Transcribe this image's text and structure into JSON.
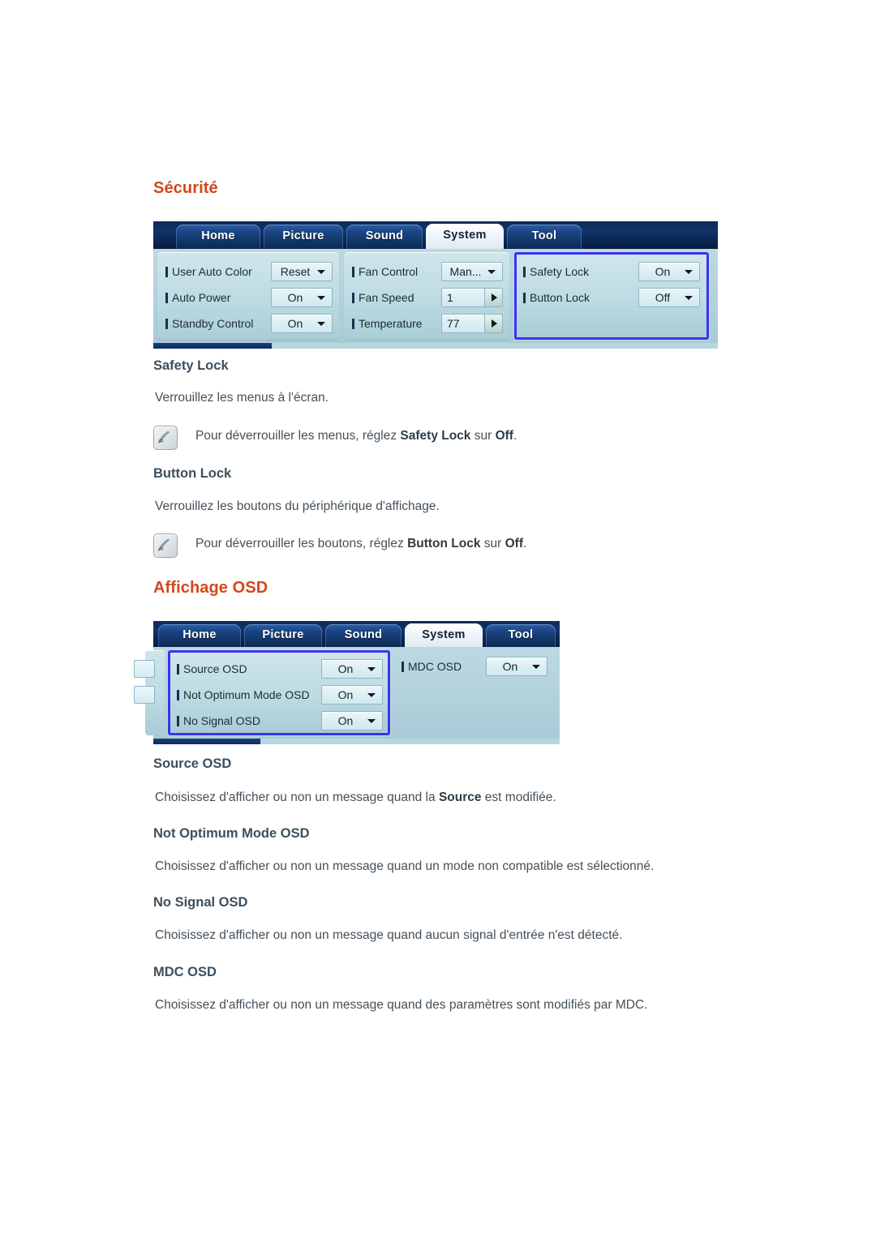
{
  "document": {
    "sections": [
      {
        "id": "securite",
        "title": "Sécurité",
        "entries": [
          {
            "heading": "Safety Lock",
            "description": "Verrouillez les menus à l'écran.",
            "note_prefix": "Pour déverrouiller les menus, réglez ",
            "note_bold_1": "Safety Lock",
            "note_mid": " sur ",
            "note_bold_2": "Off",
            "note_suffix": "."
          },
          {
            "heading": "Button Lock",
            "description": "Verrouillez les boutons du périphérique d'affichage.",
            "note_prefix": "Pour déverrouiller les boutons, réglez ",
            "note_bold_1": "Button Lock",
            "note_mid": " sur ",
            "note_bold_2": "Off",
            "note_suffix": "."
          }
        ]
      },
      {
        "id": "affichage-osd",
        "title": "Affichage OSD",
        "entries": [
          {
            "heading": "Source OSD",
            "desc_prefix": "Choisissez d'afficher ou non un message quand la ",
            "desc_bold": "Source",
            "desc_suffix": " est modifiée."
          },
          {
            "heading": "Not Optimum Mode OSD",
            "description": "Choisissez d'afficher ou non un message quand un mode non compatible est sélectionné."
          },
          {
            "heading": "No Signal OSD",
            "description": "Choisissez d'afficher ou non un message quand aucun signal d'entrée n'est détecté."
          },
          {
            "heading": "MDC OSD",
            "description": "Choisissez d'afficher ou non un message quand des paramètres sont modifiés par MDC."
          }
        ]
      }
    ]
  },
  "osd_system": {
    "tabs": [
      {
        "label": "Home",
        "active": false
      },
      {
        "label": "Picture",
        "active": false
      },
      {
        "label": "Sound",
        "active": false
      },
      {
        "label": "System",
        "active": true
      },
      {
        "label": "Tool",
        "active": false
      }
    ],
    "columns": [
      {
        "selected": false,
        "rows": [
          {
            "label": "User Auto Color",
            "value": "Reset",
            "control": "dropdown"
          },
          {
            "label": "Auto Power",
            "value": "On",
            "control": "dropdown"
          },
          {
            "label": "Standby Control",
            "value": "On",
            "control": "dropdown"
          }
        ]
      },
      {
        "selected": false,
        "rows": [
          {
            "label": "Fan Control",
            "value": "Man...",
            "control": "dropdown"
          },
          {
            "label": "Fan Speed",
            "value": "1",
            "control": "spinner"
          },
          {
            "label": "Temperature",
            "value": "77",
            "control": "spinner"
          }
        ]
      },
      {
        "selected": true,
        "rows": [
          {
            "label": "Safety Lock",
            "value": "On",
            "control": "dropdown"
          },
          {
            "label": "Button Lock",
            "value": "Off",
            "control": "dropdown"
          }
        ]
      }
    ]
  },
  "osd_osd_display": {
    "tabs": [
      {
        "label": "Home",
        "active": false
      },
      {
        "label": "Picture",
        "active": false
      },
      {
        "label": "Sound",
        "active": false
      },
      {
        "label": "System",
        "active": true
      },
      {
        "label": "Tool",
        "active": false
      }
    ],
    "columns": [
      {
        "selected": true,
        "rows": [
          {
            "label": "Source OSD",
            "value": "On",
            "control": "dropdown"
          },
          {
            "label": "Not Optimum Mode OSD",
            "value": "On",
            "control": "dropdown"
          },
          {
            "label": "No Signal OSD",
            "value": "On",
            "control": "dropdown"
          }
        ]
      },
      {
        "selected": false,
        "rows": [
          {
            "label": "MDC OSD",
            "value": "On",
            "control": "dropdown"
          }
        ]
      }
    ]
  },
  "colors": {
    "heading": "#d2481a",
    "subheading": "#3d4f5c",
    "body": "#44505a",
    "osd_selection": "#3b32ee",
    "osd_tabbar": "#0e2a54",
    "osd_panel": "#a8c9d5"
  },
  "icons": {
    "note": "note-pen-icon"
  }
}
